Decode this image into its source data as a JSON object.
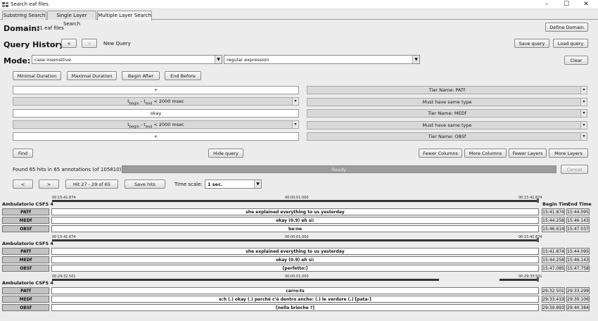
{
  "window": {
    "title": "Search eaf files",
    "minimize": "–",
    "maximize": "☐",
    "close": "✕"
  },
  "tabs": [
    {
      "label": "Substring Search",
      "active": false
    },
    {
      "label": "Single Layer Search",
      "active": false
    },
    {
      "label": "Multiple Layer Search",
      "active": true
    }
  ],
  "domain": {
    "label": "Domain:",
    "value": "31 eaf files",
    "define_button": "Define Domain"
  },
  "history": {
    "label": "Query History:",
    "prev": "<",
    "next": ">",
    "current": "New Query",
    "save_button": "Save query",
    "load_button": "Load query"
  },
  "mode": {
    "label": "Mode:",
    "case_value": "case insensitive",
    "regex_value": "regular expression",
    "clear_button": "Clear"
  },
  "constraint_buttons": [
    "Minimal Duration",
    "Maximal Duration",
    "Begin After",
    "End Before"
  ],
  "query_rows": {
    "row1_value": "+",
    "row1_tier": "Tier Name: PATf",
    "dist1_prefix": "t",
    "dist1_sub1": "begin",
    "dist1_mid": " - t",
    "dist1_sub2": "end",
    "dist1_suffix": " < 2000 msec",
    "same1": "Must have same type",
    "row2_value": "okay",
    "row2_tier": "Tier Name: MEDf",
    "dist2_prefix": "t",
    "dist2_sub1": "begin",
    "dist2_mid": " - t",
    "dist2_sub2": "end",
    "dist2_suffix": " < 2000 msec",
    "same2": "Must have same type",
    "row3_value": "+",
    "row3_tier": "Tier Name: OBSf"
  },
  "actions": {
    "find": "Find",
    "hide_query": "Hide query",
    "fewer_columns": "Fewer Columns",
    "more_columns": "More Columns",
    "fewer_layers": "Fewer Layers",
    "more_layers": "More Layers"
  },
  "status": {
    "found": "Found 65 hits in 65 annotations (of 105810)",
    "progress_text": "Ready",
    "cancel": "Cancel"
  },
  "navigation": {
    "prev": "<",
    "next": ">",
    "hits": "Hit 27 - 29 of 65",
    "save_hits": "Save hits",
    "time_scale_label": "Time scale:",
    "time_scale_value": "1 sec."
  },
  "columns": {
    "begin": "Begin Tim",
    "end": "End Time"
  },
  "results": [
    {
      "title": "Ambulatorio CSFS 4",
      "t_left": "00:15:41.874",
      "t_mid": "00:00:01.000",
      "t_right": "00:15:42.874",
      "rows": [
        {
          "tier": "PATf",
          "text": "she explained everything to us yesterday",
          "begin": "15:41.874",
          "end": "15:44.095"
        },
        {
          "tier": "MEDf",
          "text": "okay (0.9) eh si:",
          "begin": "15:44.258",
          "end": "15:46.143"
        },
        {
          "tier": "OBSf",
          "text": "be:ne",
          "begin": "15:46.614",
          "end": "15:47.037"
        }
      ]
    },
    {
      "title": "Ambulatorio CSFS 4",
      "t_left": "00:15:41.874",
      "t_mid": "00:00:01.000",
      "t_right": "00:15:42.874",
      "rows": [
        {
          "tier": "PATf",
          "text": "she explained everything to us yesterday",
          "begin": "15:41.874",
          "end": "15:44.095"
        },
        {
          "tier": "MEDf",
          "text": "okay (0.9) eh si:",
          "begin": "15:44.258",
          "end": "15:46.143"
        },
        {
          "tier": "OBSf",
          "text": "[perfetto:]",
          "begin": "15:47.085",
          "end": "15:47.758"
        }
      ]
    },
    {
      "title": "Ambulatorio CSFS 4",
      "t_left": "00:29:32.501",
      "t_mid": "00:00:01.000",
      "t_right": "00:29:33.501",
      "rows": [
        {
          "tier": "PATf",
          "text": "carro:ts",
          "begin": "29:32.501",
          "end": "29:33.299"
        },
        {
          "tier": "MEDf",
          "text": "e:h (.) okay (.) perché c'è dentro anche: (.) le verdure (.) [pata-]",
          "begin": "29:33.419",
          "end": "29:39.106"
        },
        {
          "tier": "OBSf",
          "text": "[nella brioche ?]",
          "begin": "29:39.893",
          "end": "29:40.384"
        }
      ]
    }
  ]
}
